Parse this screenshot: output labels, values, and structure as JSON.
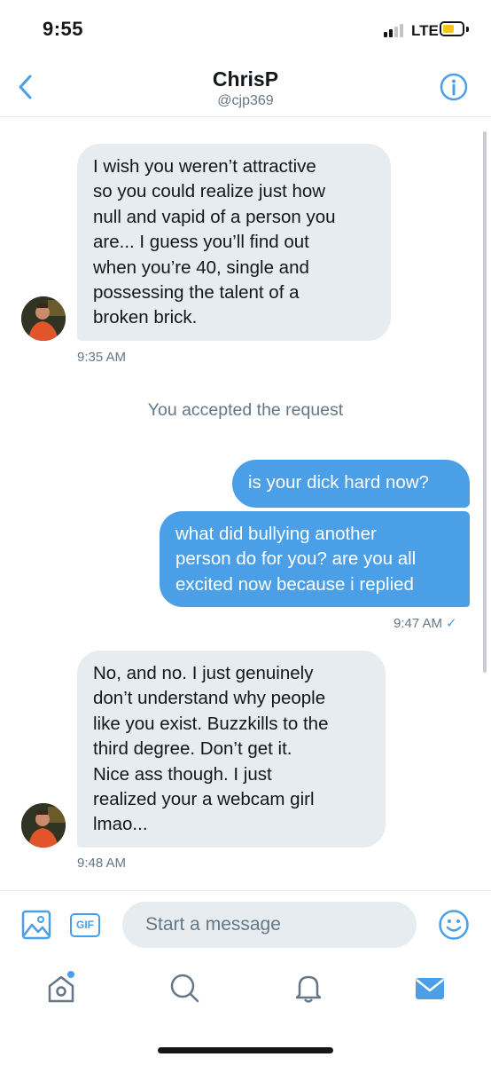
{
  "status_bar": {
    "time": "9:55",
    "network": "LTE",
    "battery_color": "#f5c518"
  },
  "header": {
    "name": "ChrisP",
    "handle": "@cjp369",
    "back_icon": "chevron-left-icon",
    "info_icon": "info-icon"
  },
  "messages": [
    {
      "direction": "incoming",
      "text_lines": [
        "I wish you weren’t attractive",
        "so you could realize just how",
        "null and vapid of a person you",
        "are... I guess you’ll find out",
        "when you’re 40, single and",
        "possessing the talent of a",
        "broken brick."
      ],
      "timestamp": "9:35 AM"
    },
    {
      "direction": "system",
      "text": "You accepted the request"
    },
    {
      "direction": "outgoing",
      "text_lines": [
        "is your dick hard now?"
      ]
    },
    {
      "direction": "outgoing",
      "text_lines": [
        "what did bullying another",
        "person do for you? are you all",
        "excited now because i replied"
      ],
      "timestamp": "9:47 AM",
      "read_mark": "✓"
    },
    {
      "direction": "incoming",
      "text_lines": [
        "No, and no. I just genuinely",
        "don’t understand why people",
        "like you exist. Buzzkills to the",
        "third degree. Don’t get it.",
        "Nice ass though. I just",
        "realized your a webcam girl",
        "lmao..."
      ],
      "timestamp": "9:48 AM"
    }
  ],
  "composer": {
    "placeholder": "Start a message",
    "gif_label": "GIF",
    "media_icon": "image-icon",
    "emoji_icon": "smiley-icon"
  },
  "tab_bar": {
    "items": [
      "home-icon",
      "search-icon",
      "notifications-icon",
      "messages-icon"
    ],
    "active": "messages-icon",
    "home_has_dot": true
  },
  "colors": {
    "accent": "#4a9fe6",
    "incoming_bubble": "#e6ecf0",
    "secondary_text": "#657786"
  }
}
